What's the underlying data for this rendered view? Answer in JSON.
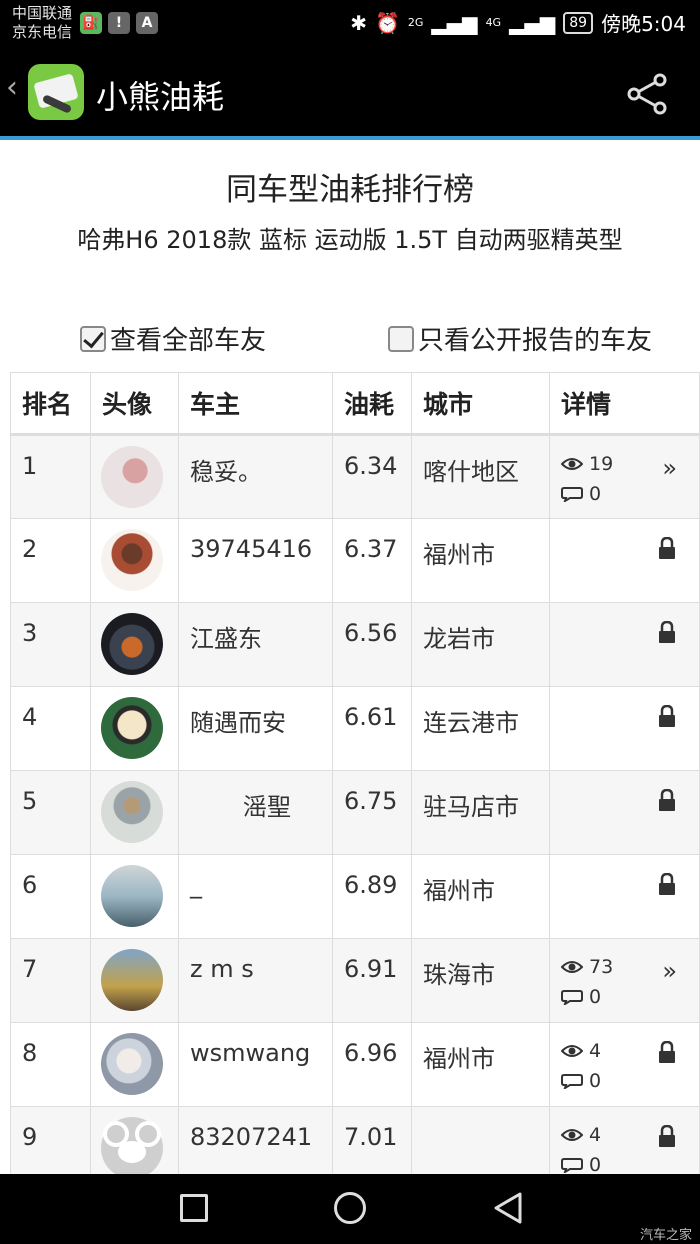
{
  "status_bar": {
    "carrier_1": "中国联通",
    "carrier_2": "京东电信",
    "icon_a": "A",
    "battery": "89",
    "time": "傍晚5:04",
    "signal_1": "2G",
    "signal_2": "4G"
  },
  "app_bar": {
    "title": "小熊油耗",
    "back_icon": "chevron-left-icon",
    "share_icon": "share-icon"
  },
  "heading": {
    "title": "同车型油耗排行榜",
    "subtitle": "哈弗H6 2018款 蓝标 运动版 1.5T 自动两驱精英型"
  },
  "filters": {
    "all_label": "查看全部车友",
    "all_checked": true,
    "public_label": "只看公开报告的车友",
    "public_checked": false
  },
  "table": {
    "headers": [
      "排名",
      "头像",
      "车主",
      "油耗",
      "城市",
      "详情"
    ],
    "rows": [
      {
        "rank": "1",
        "owner": "稳妥。",
        "owner_prefix": "",
        "fuel": "6.34",
        "city": "喀什地区",
        "views": "19",
        "comments": "0",
        "action": "open"
      },
      {
        "rank": "2",
        "owner": "39745416",
        "fuel": "6.37",
        "city": "福州市",
        "views": "",
        "comments": "",
        "action": "locked"
      },
      {
        "rank": "3",
        "owner": "江盛东",
        "fuel": "6.56",
        "city": "龙岩市",
        "views": "",
        "comments": "",
        "action": "locked"
      },
      {
        "rank": "4",
        "owner": "随遇而安",
        "fuel": "6.61",
        "city": "连云港市",
        "views": "",
        "comments": "",
        "action": "locked"
      },
      {
        "rank": "5",
        "owner": "滛聖",
        "fuel": "6.75",
        "city": "驻马店市",
        "views": "",
        "comments": "",
        "action": "locked"
      },
      {
        "rank": "6",
        "owner": "_",
        "fuel": "6.89",
        "city": "福州市",
        "views": "",
        "comments": "",
        "action": "locked"
      },
      {
        "rank": "7",
        "owner": "z m s",
        "fuel": "6.91",
        "city": "珠海市",
        "views": "73",
        "comments": "0",
        "action": "open"
      },
      {
        "rank": "8",
        "owner": "wsmwang",
        "fuel": "6.96",
        "city": "福州市",
        "views": "4",
        "comments": "0",
        "action": "locked"
      },
      {
        "rank": "9",
        "owner": "83207241",
        "fuel": "7.01",
        "city": "",
        "views": "4",
        "comments": "0",
        "action": "locked"
      }
    ],
    "open_arrow": "»"
  },
  "watermark": "汽车之家"
}
